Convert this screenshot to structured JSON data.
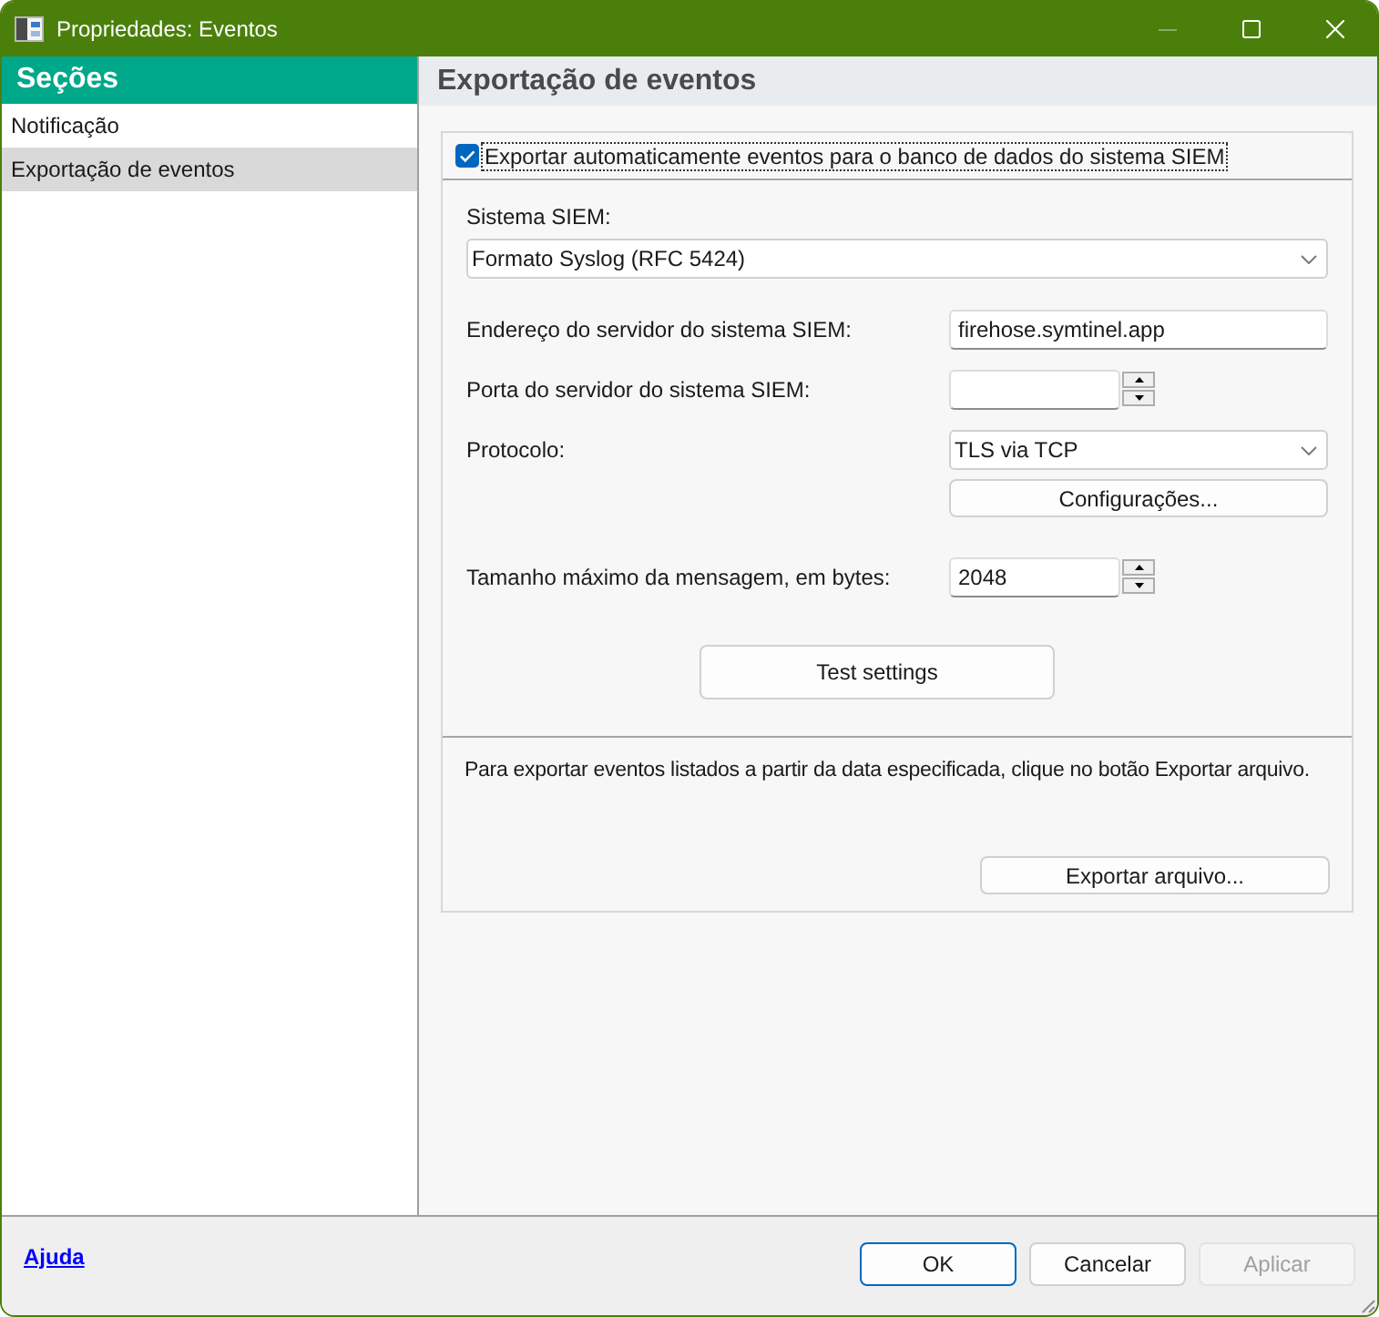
{
  "window": {
    "title": "Propriedades: Eventos",
    "controls": [
      {
        "kind": "minimize",
        "disabled": true
      },
      {
        "kind": "maximize",
        "disabled": false
      },
      {
        "kind": "close",
        "disabled": false
      }
    ]
  },
  "sidebar": {
    "title": "Seções",
    "items": [
      {
        "label": "Notificação",
        "selected": false
      },
      {
        "label": "Exportação de eventos",
        "selected": true
      }
    ]
  },
  "panel": {
    "title": "Exportação de eventos",
    "auto_export": {
      "label": "Exportar automaticamente eventos para o banco de dados do sistema SIEM",
      "checked": true
    },
    "siem_system": {
      "label": "Sistema SIEM:",
      "value": "Formato Syslog (RFC 5424)"
    },
    "fields": [
      {
        "kind": "text",
        "label": "Endereço do servidor do sistema SIEM:",
        "value": "firehose.symtinel.app"
      },
      {
        "kind": "spin",
        "label": "Porta do servidor do sistema SIEM:"
      },
      {
        "kind": "dropdown",
        "label": "Protocolo:",
        "value": "TLS via TCP",
        "button": "Configurações..."
      },
      {
        "kind": "spin",
        "label": "Tamanho máximo da mensagem, em bytes:",
        "value": "2048"
      }
    ],
    "test_button": "Test settings",
    "file_export": {
      "text": "Para exportar eventos listados a partir da data especificada, clique no botão Exportar arquivo.",
      "button": "Exportar arquivo..."
    }
  },
  "footer": {
    "help_link": "Ajuda",
    "buttons": [
      {
        "label": "OK",
        "default": true,
        "disabled": false
      },
      {
        "label": "Cancelar",
        "default": false,
        "disabled": false
      },
      {
        "label": "Aplicar",
        "default": false,
        "disabled": true
      }
    ]
  }
}
